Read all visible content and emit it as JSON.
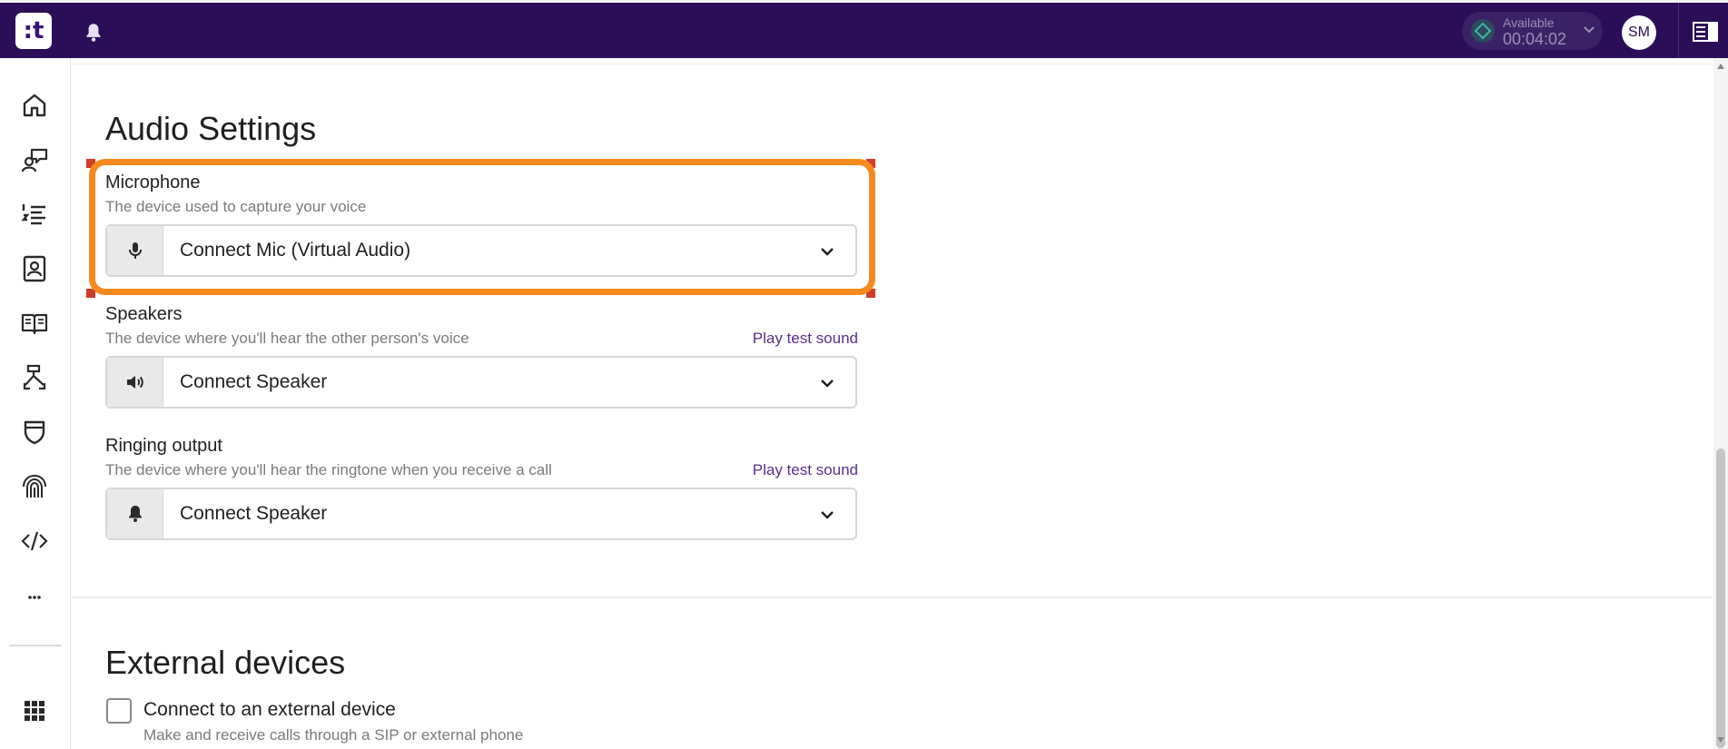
{
  "topbar": {
    "logo_text": ":t",
    "status": {
      "label": "Available",
      "timer": "00:04:02"
    },
    "avatar_initials": "SM"
  },
  "sidebar": {
    "items": [
      {
        "name": "home",
        "icon": "home-icon"
      },
      {
        "name": "conversations",
        "icon": "chat-person-icon"
      },
      {
        "name": "lists",
        "icon": "numbered-list-icon"
      },
      {
        "name": "contacts",
        "icon": "contact-card-icon"
      },
      {
        "name": "knowledge",
        "icon": "open-book-icon"
      },
      {
        "name": "workflows",
        "icon": "flow-icon"
      },
      {
        "name": "security",
        "icon": "shield-icon"
      },
      {
        "name": "biometrics",
        "icon": "fingerprint-icon"
      },
      {
        "name": "developer",
        "icon": "code-icon"
      },
      {
        "name": "more",
        "icon": "ellipsis-icon",
        "label": "..."
      },
      {
        "name": "apps",
        "icon": "app-grid-icon"
      }
    ]
  },
  "audio": {
    "title": "Audio Settings",
    "microphone": {
      "label": "Microphone",
      "description": "The device used to capture your voice",
      "value": "Connect Mic (Virtual Audio)"
    },
    "speakers": {
      "label": "Speakers",
      "description": "The device where you'll hear the other person's voice",
      "test_link": "Play test sound",
      "value": "Connect Speaker"
    },
    "ringing": {
      "label": "Ringing output",
      "description": "The device where you'll hear the ringtone when you receive a call",
      "test_link": "Play test sound",
      "value": "Connect Speaker"
    }
  },
  "external": {
    "title": "External devices",
    "checkbox_label": "Connect to an external device",
    "checkbox_description": "Make and receive calls through a SIP or external phone",
    "checked": false
  },
  "colors": {
    "topbar": "#2b0e57",
    "highlight": "#f58a1f",
    "link": "#5a2d8c"
  }
}
